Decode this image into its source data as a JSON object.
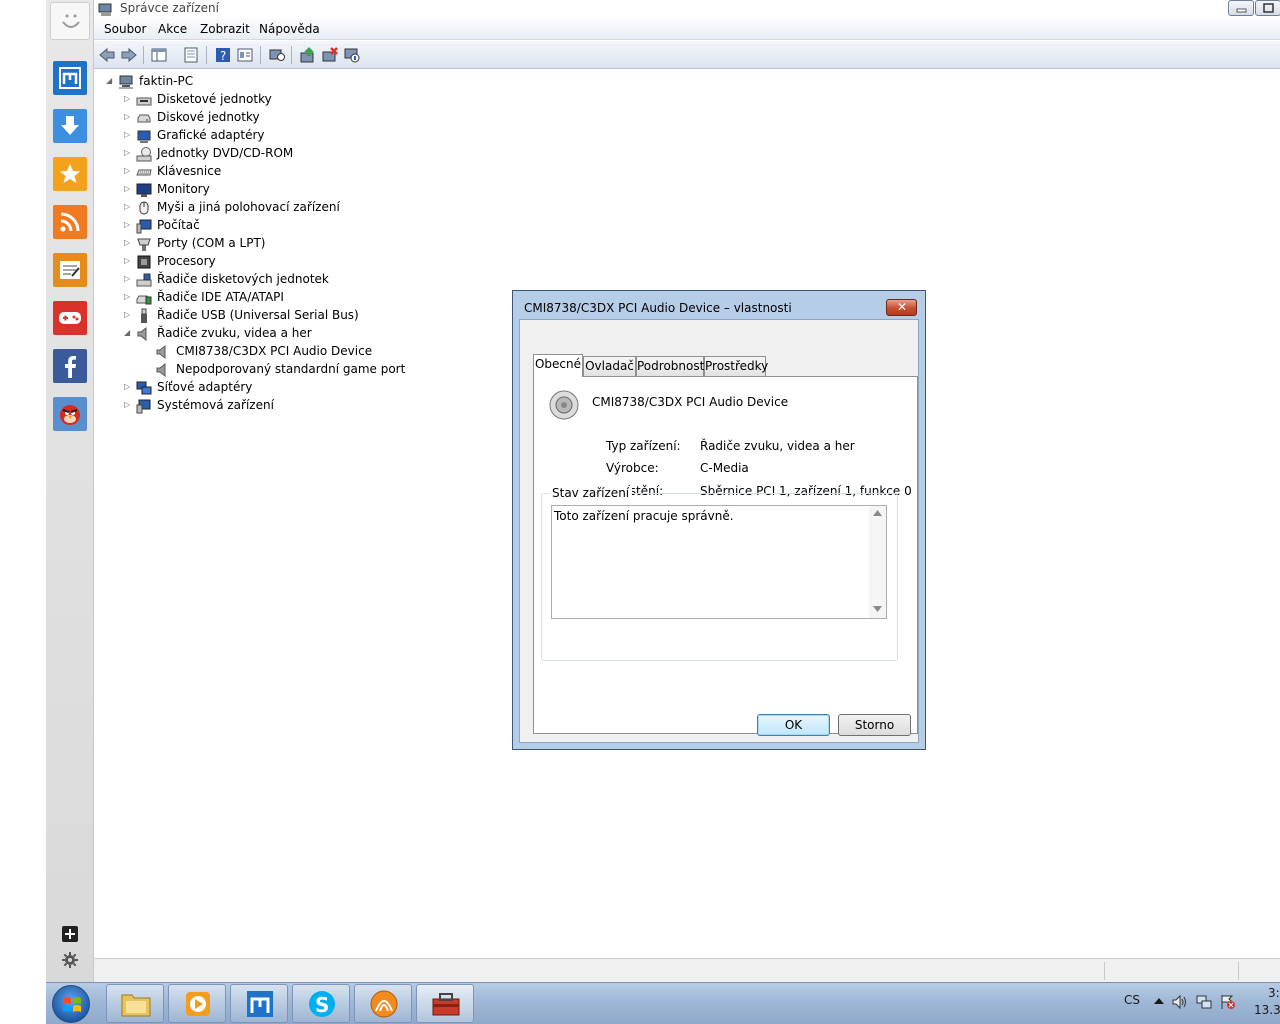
{
  "window": {
    "title": "Správce zařízení",
    "menu": [
      "Soubor",
      "Akce",
      "Zobrazit",
      "Nápověda"
    ]
  },
  "tree": {
    "root": "faktin-PC",
    "items": [
      {
        "label": "Disketové jednotky",
        "expanded": false
      },
      {
        "label": "Diskové jednotky",
        "expanded": false
      },
      {
        "label": "Grafické adaptéry",
        "expanded": false
      },
      {
        "label": "Jednotky DVD/CD-ROM",
        "expanded": false
      },
      {
        "label": "Klávesnice",
        "expanded": false
      },
      {
        "label": "Monitory",
        "expanded": false
      },
      {
        "label": "Myši a jiná polohovací zařízení",
        "expanded": false
      },
      {
        "label": "Počítač",
        "expanded": false
      },
      {
        "label": "Porty (COM a LPT)",
        "expanded": false
      },
      {
        "label": "Procesory",
        "expanded": false
      },
      {
        "label": "Řadiče disketových jednotek",
        "expanded": false
      },
      {
        "label": "Řadiče IDE ATA/ATAPI",
        "expanded": false
      },
      {
        "label": "Řadiče USB (Universal Serial Bus)",
        "expanded": false
      },
      {
        "label": "Řadiče zvuku, videa a her",
        "expanded": true
      },
      {
        "label": "Síťové adaptéry",
        "expanded": false
      },
      {
        "label": "Systémová zařízení",
        "expanded": false
      }
    ],
    "children": [
      "CMI8738/C3DX PCI Audio Device",
      "Nepodporovaný standardní game port"
    ]
  },
  "dialog": {
    "title": "CMI8738/C3DX PCI Audio Device – vlastnosti",
    "tabs": [
      "Obecné",
      "Ovladač",
      "Podrobnosti",
      "Prostředky"
    ],
    "active_tab": "Obecné",
    "device_name": "CMI8738/C3DX PCI Audio Device",
    "fields": [
      {
        "label": "Typ zařízení:",
        "value": "Řadiče zvuku, videa a her"
      },
      {
        "label": "Výrobce:",
        "value": "C-Media"
      },
      {
        "label": "Umístění:",
        "value": "Sběrnice PCI 1, zařízení 1, funkce 0"
      }
    ],
    "status_group": "Stav zařízení",
    "status_text": "Toto zařízení pracuje správně.",
    "ok": "OK",
    "cancel": "Storno"
  },
  "taskbar": {
    "lang": "CS",
    "time": "3:",
    "date": "13.3."
  },
  "colors": {
    "taskbar": "#9fb8d6",
    "dialog_frame": "#b6cde8",
    "accent": "#3c7fb1"
  }
}
